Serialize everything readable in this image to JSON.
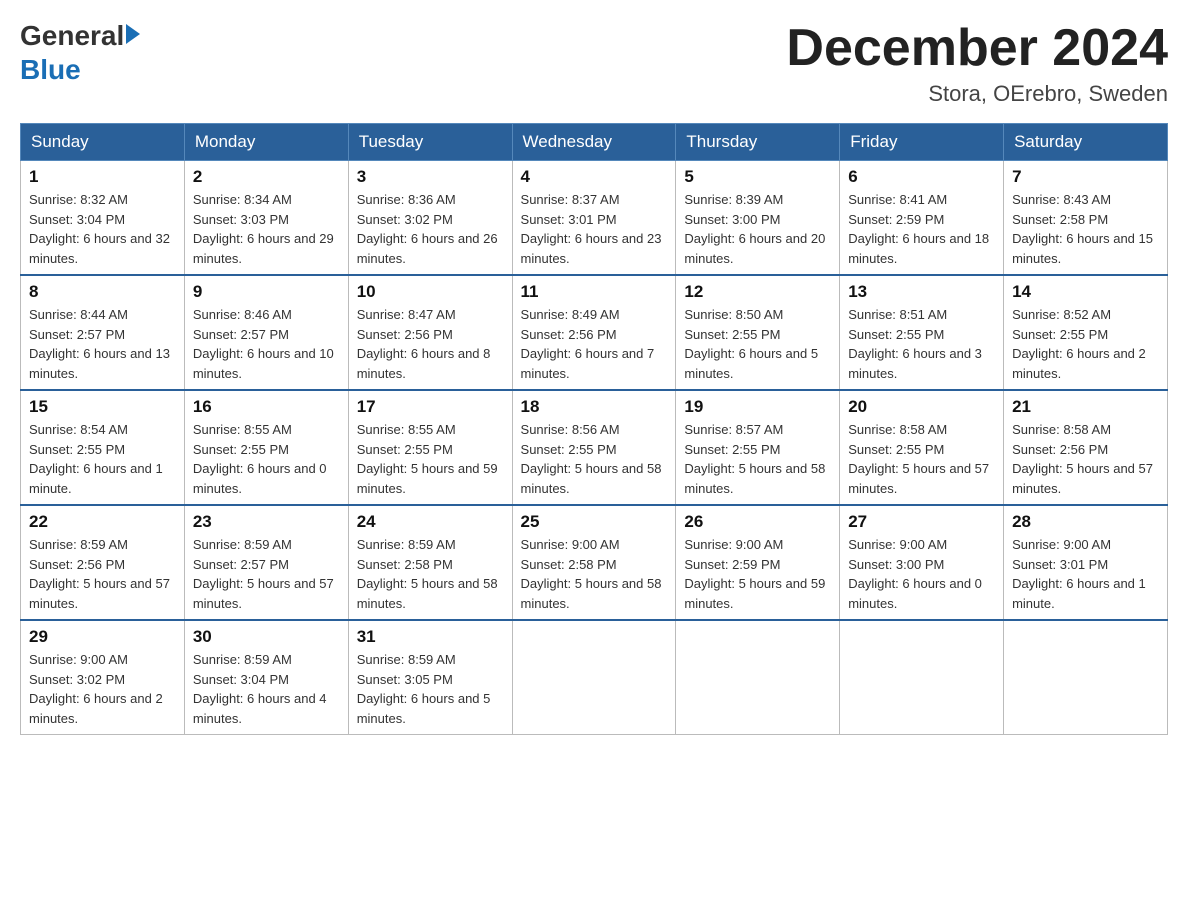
{
  "header": {
    "logo_general": "General",
    "logo_blue": "Blue",
    "title": "December 2024",
    "subtitle": "Stora, OErebro, Sweden"
  },
  "weekdays": [
    "Sunday",
    "Monday",
    "Tuesday",
    "Wednesday",
    "Thursday",
    "Friday",
    "Saturday"
  ],
  "weeks": [
    [
      {
        "day": "1",
        "sunrise": "8:32 AM",
        "sunset": "3:04 PM",
        "daylight": "6 hours and 32 minutes."
      },
      {
        "day": "2",
        "sunrise": "8:34 AM",
        "sunset": "3:03 PM",
        "daylight": "6 hours and 29 minutes."
      },
      {
        "day": "3",
        "sunrise": "8:36 AM",
        "sunset": "3:02 PM",
        "daylight": "6 hours and 26 minutes."
      },
      {
        "day": "4",
        "sunrise": "8:37 AM",
        "sunset": "3:01 PM",
        "daylight": "6 hours and 23 minutes."
      },
      {
        "day": "5",
        "sunrise": "8:39 AM",
        "sunset": "3:00 PM",
        "daylight": "6 hours and 20 minutes."
      },
      {
        "day": "6",
        "sunrise": "8:41 AM",
        "sunset": "2:59 PM",
        "daylight": "6 hours and 18 minutes."
      },
      {
        "day": "7",
        "sunrise": "8:43 AM",
        "sunset": "2:58 PM",
        "daylight": "6 hours and 15 minutes."
      }
    ],
    [
      {
        "day": "8",
        "sunrise": "8:44 AM",
        "sunset": "2:57 PM",
        "daylight": "6 hours and 13 minutes."
      },
      {
        "day": "9",
        "sunrise": "8:46 AM",
        "sunset": "2:57 PM",
        "daylight": "6 hours and 10 minutes."
      },
      {
        "day": "10",
        "sunrise": "8:47 AM",
        "sunset": "2:56 PM",
        "daylight": "6 hours and 8 minutes."
      },
      {
        "day": "11",
        "sunrise": "8:49 AM",
        "sunset": "2:56 PM",
        "daylight": "6 hours and 7 minutes."
      },
      {
        "day": "12",
        "sunrise": "8:50 AM",
        "sunset": "2:55 PM",
        "daylight": "6 hours and 5 minutes."
      },
      {
        "day": "13",
        "sunrise": "8:51 AM",
        "sunset": "2:55 PM",
        "daylight": "6 hours and 3 minutes."
      },
      {
        "day": "14",
        "sunrise": "8:52 AM",
        "sunset": "2:55 PM",
        "daylight": "6 hours and 2 minutes."
      }
    ],
    [
      {
        "day": "15",
        "sunrise": "8:54 AM",
        "sunset": "2:55 PM",
        "daylight": "6 hours and 1 minute."
      },
      {
        "day": "16",
        "sunrise": "8:55 AM",
        "sunset": "2:55 PM",
        "daylight": "6 hours and 0 minutes."
      },
      {
        "day": "17",
        "sunrise": "8:55 AM",
        "sunset": "2:55 PM",
        "daylight": "5 hours and 59 minutes."
      },
      {
        "day": "18",
        "sunrise": "8:56 AM",
        "sunset": "2:55 PM",
        "daylight": "5 hours and 58 minutes."
      },
      {
        "day": "19",
        "sunrise": "8:57 AM",
        "sunset": "2:55 PM",
        "daylight": "5 hours and 58 minutes."
      },
      {
        "day": "20",
        "sunrise": "8:58 AM",
        "sunset": "2:55 PM",
        "daylight": "5 hours and 57 minutes."
      },
      {
        "day": "21",
        "sunrise": "8:58 AM",
        "sunset": "2:56 PM",
        "daylight": "5 hours and 57 minutes."
      }
    ],
    [
      {
        "day": "22",
        "sunrise": "8:59 AM",
        "sunset": "2:56 PM",
        "daylight": "5 hours and 57 minutes."
      },
      {
        "day": "23",
        "sunrise": "8:59 AM",
        "sunset": "2:57 PM",
        "daylight": "5 hours and 57 minutes."
      },
      {
        "day": "24",
        "sunrise": "8:59 AM",
        "sunset": "2:58 PM",
        "daylight": "5 hours and 58 minutes."
      },
      {
        "day": "25",
        "sunrise": "9:00 AM",
        "sunset": "2:58 PM",
        "daylight": "5 hours and 58 minutes."
      },
      {
        "day": "26",
        "sunrise": "9:00 AM",
        "sunset": "2:59 PM",
        "daylight": "5 hours and 59 minutes."
      },
      {
        "day": "27",
        "sunrise": "9:00 AM",
        "sunset": "3:00 PM",
        "daylight": "6 hours and 0 minutes."
      },
      {
        "day": "28",
        "sunrise": "9:00 AM",
        "sunset": "3:01 PM",
        "daylight": "6 hours and 1 minute."
      }
    ],
    [
      {
        "day": "29",
        "sunrise": "9:00 AM",
        "sunset": "3:02 PM",
        "daylight": "6 hours and 2 minutes."
      },
      {
        "day": "30",
        "sunrise": "8:59 AM",
        "sunset": "3:04 PM",
        "daylight": "6 hours and 4 minutes."
      },
      {
        "day": "31",
        "sunrise": "8:59 AM",
        "sunset": "3:05 PM",
        "daylight": "6 hours and 5 minutes."
      },
      null,
      null,
      null,
      null
    ]
  ]
}
